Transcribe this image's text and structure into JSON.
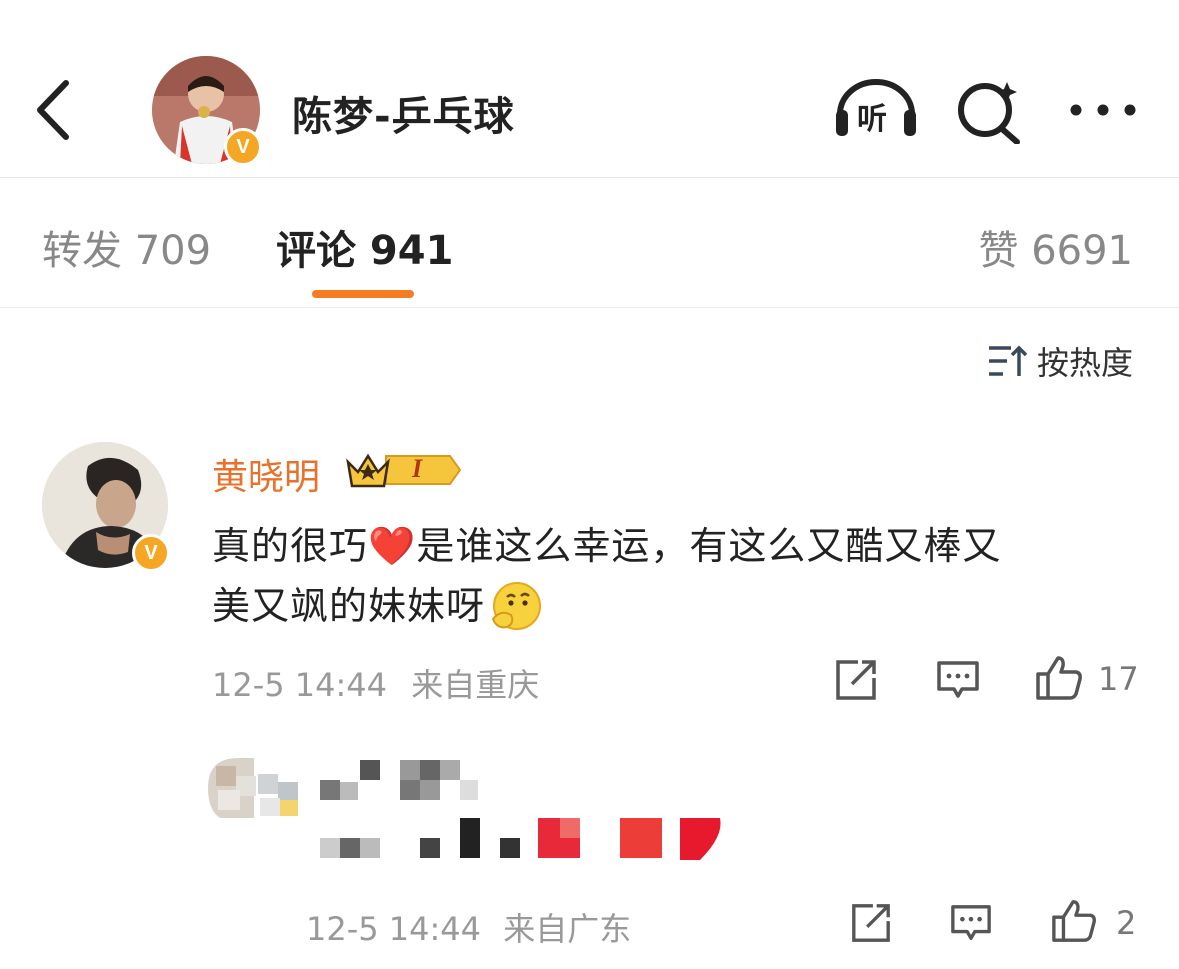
{
  "header": {
    "title": "陈梦-乒乓球",
    "listen_label": "听",
    "icons": [
      "back-arrow-icon",
      "listen-headphones-icon",
      "search-icon",
      "more-icon"
    ]
  },
  "tabs": {
    "repost": "转发 709",
    "comment": "评论 941",
    "like": "赞 6691",
    "active": "comment",
    "accent": "#f77b23"
  },
  "sort": {
    "label": "按热度"
  },
  "comment": {
    "user": "黄晓明",
    "member_badge": "I",
    "text_line1": "真的很巧❤️是谁这么幸运，有这么又酷又棒又",
    "text_line2": "美又飒的妹妹呀",
    "time": "12-5 14:44",
    "location": "来自重庆",
    "likes": "17",
    "name_color": "#e8712c"
  },
  "reply": {
    "time": "12-5 14:44",
    "location": "来自广东",
    "likes": "2"
  }
}
